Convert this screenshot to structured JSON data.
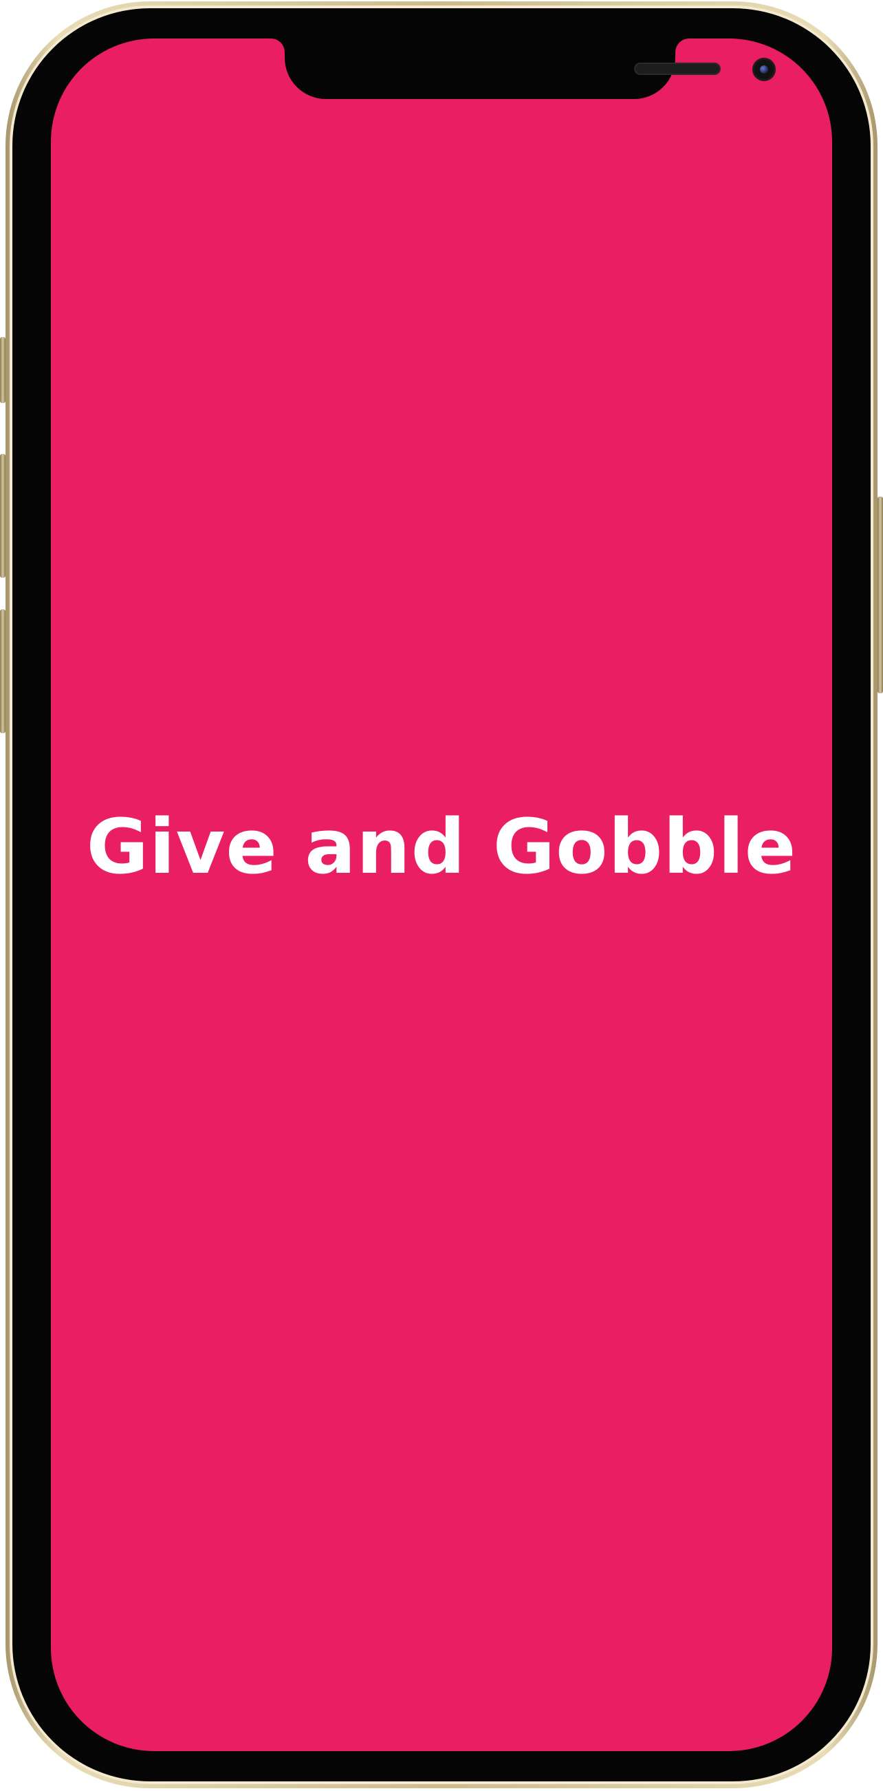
{
  "app": {
    "title": "Give and Gobble",
    "background_color": "#E91E63",
    "text_color": "#FFFFFF"
  },
  "device": {
    "frame_color": "#CDBB8E",
    "bezel_color": "#050505"
  }
}
